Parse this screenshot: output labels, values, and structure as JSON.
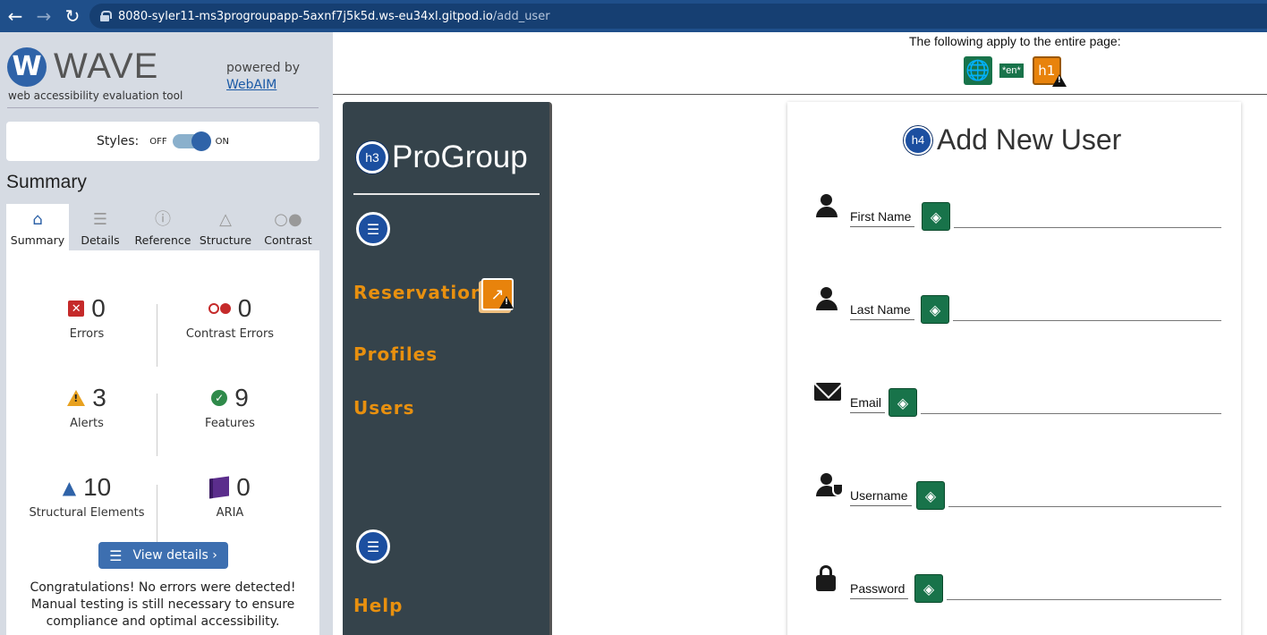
{
  "browser": {
    "back_icon": "arrow-left-icon",
    "forward_icon": "arrow-right-icon",
    "reload_icon": "reload-icon",
    "url_host": "8080-syler11-ms3progroupapp-5axnf7j5k5d.ws-eu34xl.gitpod.io",
    "url_path": "/add_user"
  },
  "wave": {
    "logo_letter": "W",
    "logo_word": "WAVE",
    "subtitle": "web accessibility evaluation tool",
    "powered_by": "powered by",
    "webaim_link": "WebAIM",
    "styles_label": "Styles:",
    "styles_off": "OFF",
    "styles_on": "ON",
    "styles_enabled": true,
    "summary_heading": "Summary",
    "tabs": [
      {
        "label": "Summary",
        "icon": "home-icon",
        "active": true
      },
      {
        "label": "Details",
        "icon": "list-icon",
        "active": false
      },
      {
        "label": "Reference",
        "icon": "info-icon",
        "active": false
      },
      {
        "label": "Structure",
        "icon": "structure-icon",
        "active": false
      },
      {
        "label": "Contrast",
        "icon": "contrast-icon",
        "active": false
      }
    ],
    "stats": {
      "errors": {
        "value": "0",
        "label": "Errors"
      },
      "contrast_errors": {
        "value": "0",
        "label": "Contrast Errors"
      },
      "alerts": {
        "value": "3",
        "label": "Alerts"
      },
      "features": {
        "value": "9",
        "label": "Features"
      },
      "structural": {
        "value": "10",
        "label": "Structural Elements"
      },
      "aria": {
        "value": "0",
        "label": "ARIA"
      }
    },
    "view_details": "View details ›",
    "congrats": "Congratulations! No errors were detected! Manual testing is still necessary to ensure compliance and optimal accessibility."
  },
  "page_level": {
    "text": "The following apply to the entire page:",
    "lang_badge": "*en*",
    "h1_badge": "h1"
  },
  "app": {
    "brand_badge": "h3",
    "brand": "ProGroup",
    "nav": {
      "reservations": "Reservations",
      "profiles": "Profiles",
      "users": "Users",
      "help": "Help"
    }
  },
  "form": {
    "title_badge": "h4",
    "title": "Add New User",
    "fields": [
      {
        "label": "First Name",
        "icon": "person-icon"
      },
      {
        "label": "Last Name",
        "icon": "person-icon"
      },
      {
        "label": "Email",
        "icon": "envelope-icon"
      },
      {
        "label": "Username",
        "icon": "user-shield-icon"
      },
      {
        "label": "Password",
        "icon": "lock-icon"
      }
    ]
  },
  "colors": {
    "browser_bar": "#1f4f8a",
    "wave_blue": "#2f63a8",
    "nav_orange": "#e8900f",
    "sidebar_dark": "#35434b",
    "feature_green": "#18734a"
  }
}
